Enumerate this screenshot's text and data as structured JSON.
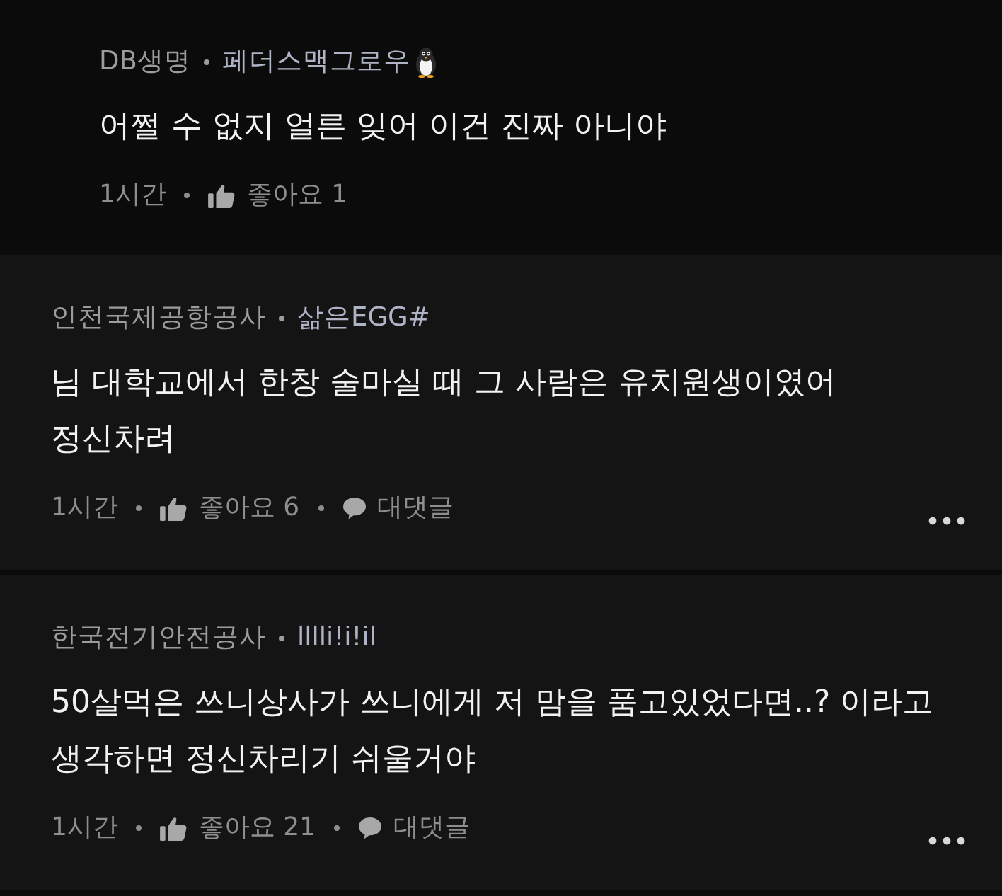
{
  "comments": [
    {
      "kind": "reply",
      "author": "DB생명",
      "nickname": "페더스맥그로우",
      "emoji": true,
      "body": "어쩔 수 없지 얼른 잊어 이건 진짜 아니야",
      "time": "1시간",
      "likes": "좋아요 1"
    },
    {
      "kind": "comment",
      "author": "인천국제공항공사",
      "nickname": "삶은EGG#",
      "emoji": false,
      "body": "님 대학교에서 한창 술마실 때 그 사람은 유치원생이였어 정신차려",
      "time": "1시간",
      "likes": "좋아요 6",
      "reply_label": "대댓글"
    },
    {
      "kind": "comment",
      "author": "한국전기안전공사",
      "nickname": "lllli!i!il",
      "emoji": false,
      "body": "50살먹은 쓰니상사가 쓰니에게 저 맘을 품고있었다면..? 이라고 생각하면 정신차리기 쉬울거야",
      "time": "1시간",
      "likes": "좋아요 21",
      "reply_label": "대댓글"
    }
  ]
}
